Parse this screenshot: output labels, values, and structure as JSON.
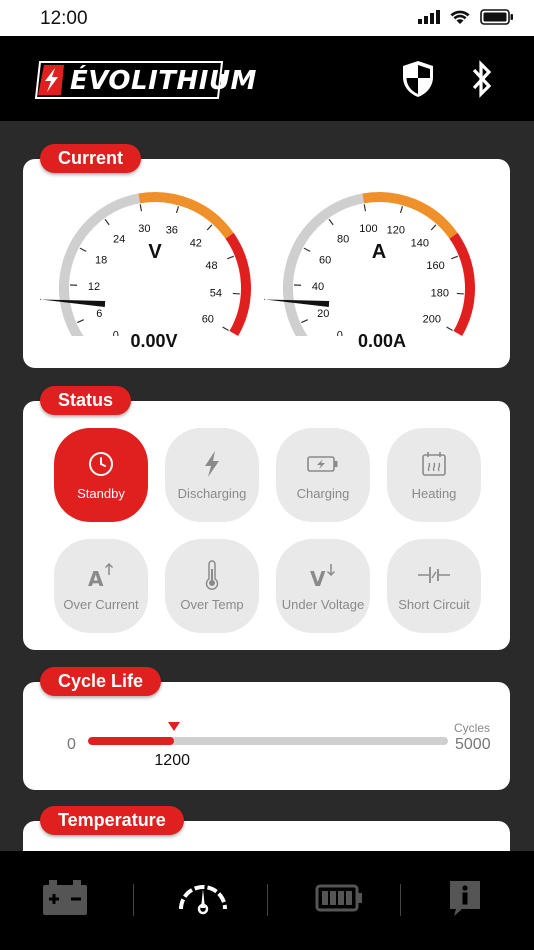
{
  "statusbar": {
    "time": "12:00",
    "icons": [
      "signal-icon",
      "wifi-icon",
      "battery-icon"
    ]
  },
  "header": {
    "logo_text": "ÉVOLITHIUM",
    "icons": [
      "shield-icon",
      "bluetooth-icon"
    ]
  },
  "current": {
    "title": "Current",
    "voltage": {
      "unit_label": "V",
      "ticks": [
        "0",
        "6",
        "12",
        "18",
        "24",
        "30",
        "36",
        "42",
        "48",
        "54",
        "60"
      ],
      "value": 0,
      "readout": "0.00V",
      "range": [
        0,
        60
      ],
      "zones": [
        {
          "to": 30,
          "color": "#cfcfcf"
        },
        {
          "to": 45,
          "color": "#f0902a"
        },
        {
          "to": 60,
          "color": "#e0201f"
        }
      ]
    },
    "amperage": {
      "unit_label": "A",
      "ticks": [
        "0",
        "20",
        "40",
        "60",
        "80",
        "100",
        "120",
        "140",
        "160",
        "180",
        "200"
      ],
      "value": 0,
      "readout": "0.00A",
      "range": [
        0,
        200
      ],
      "zones": [
        {
          "to": 100,
          "color": "#cfcfcf"
        },
        {
          "to": 150,
          "color": "#f0902a"
        },
        {
          "to": 200,
          "color": "#e0201f"
        }
      ]
    }
  },
  "status": {
    "title": "Status",
    "items": [
      {
        "label": "Standby",
        "icon": "clock-icon",
        "active": true
      },
      {
        "label": "Discharging",
        "icon": "lightning-icon",
        "active": false
      },
      {
        "label": "Charging",
        "icon": "battery-charging-icon",
        "active": false
      },
      {
        "label": "Heating",
        "icon": "heating-icon",
        "active": false
      },
      {
        "label": "Over Current",
        "icon": "over-current-icon",
        "active": false
      },
      {
        "label": "Over Temp",
        "icon": "thermometer-icon",
        "active": false
      },
      {
        "label": "Under Voltage",
        "icon": "under-voltage-icon",
        "active": false
      },
      {
        "label": "Short Circuit",
        "icon": "short-circuit-icon",
        "active": false
      }
    ]
  },
  "cycle_life": {
    "title": "Cycle Life",
    "min_label": "0",
    "max_label": "5000",
    "unit_label": "Cycles",
    "value_label": "1200",
    "value": 1200,
    "max": 5000
  },
  "temperature": {
    "title": "Temperature"
  },
  "tabbar": {
    "tabs": [
      "battery-icon",
      "gauge-icon",
      "battery-level-icon",
      "info-icon"
    ],
    "active_index": 1
  },
  "colors": {
    "accent": "#e0201f",
    "orange": "#f0902a",
    "gray": "#cfcfcf",
    "background": "#2a2a2a"
  }
}
